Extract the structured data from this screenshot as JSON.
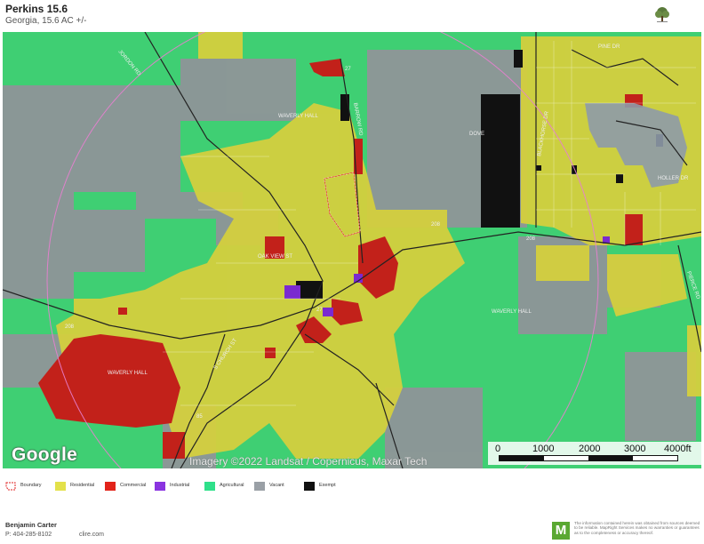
{
  "header": {
    "title": "Perkins 15.6",
    "subtitle": "Georgia, 15.6 AC +/-"
  },
  "map": {
    "attribution_logo": "Google",
    "imagery_credit": "Imagery ©2022 Landsat / Copernicus, Maxar Tech",
    "scale_labels": [
      "0",
      "1000",
      "2000",
      "3000",
      "4000ft"
    ],
    "road_labels": [
      "JORDON RD",
      "WAVERLY HALL",
      "DOVE",
      "WAVERLY HALL",
      "WAVERLY HALL",
      "208",
      "208",
      "208",
      "27",
      "27",
      "85",
      "PIERCE RD",
      "HOLLER DR",
      "BLACKHORSE DR",
      "OAK VIEW ST",
      "S CHURCH ST",
      "BARROW RD",
      "PINE DR"
    ],
    "colors": {
      "residential": "#e0dc3a",
      "commercial": "#e0221a",
      "industrial": "#8a2ce0",
      "agricultural": "#2bd675",
      "vacant": "#a4a8ad",
      "exempt": "#111111",
      "boundary": "#e02020"
    }
  },
  "legend": [
    {
      "label": "Boundary",
      "color": "#e02020",
      "icon": "boundary-outline-icon"
    },
    {
      "label": "Residential",
      "color": "#e3e14a"
    },
    {
      "label": "Commercial",
      "color": "#e2231a"
    },
    {
      "label": "Industrial",
      "color": "#8a34e0"
    },
    {
      "label": "Agricultural",
      "color": "#2fe08a"
    },
    {
      "label": "Vacant",
      "color": "#9aa0a6"
    },
    {
      "label": "Exempt",
      "color": "#111111"
    }
  ],
  "footer": {
    "name": "Benjamin Carter",
    "phone": "P: 404-285-8102",
    "website": "clire.com",
    "mapright_logo": "M",
    "disclaimer": "The information contained herein was obtained from sources deemed to be reliable. MapRight Services makes no warranties or guarantees as to the completeness or accuracy thereof."
  }
}
